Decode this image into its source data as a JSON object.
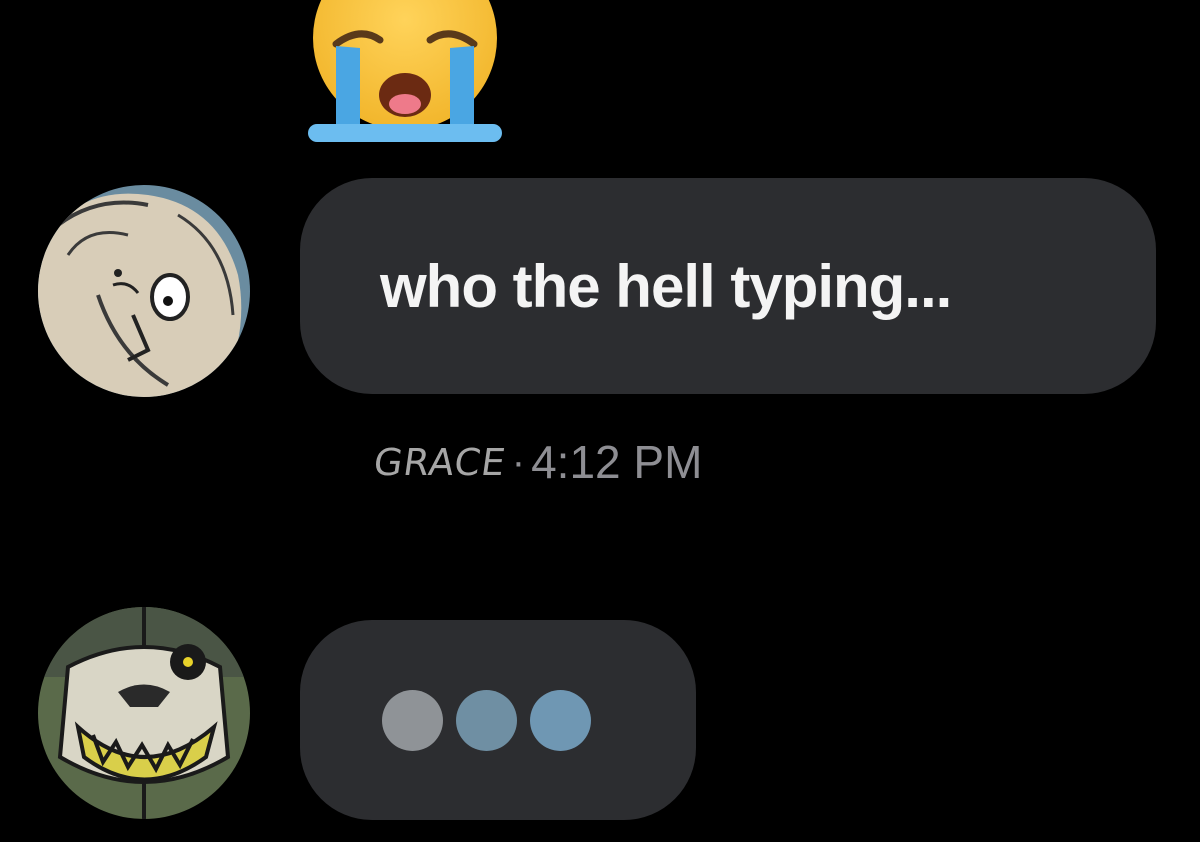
{
  "reaction": {
    "icon": "crying-face-icon"
  },
  "messages": [
    {
      "sender": "GRACE",
      "text": "who the hell typing...",
      "time": "4:12 PM",
      "separator": "·"
    }
  ],
  "typing_indicator": {
    "dot_colors": [
      "#8f9397",
      "#6f8fa3",
      "#6f97b3"
    ]
  },
  "colors": {
    "background": "#000000",
    "bubble": "#2c2d30",
    "message_text": "#f4f4f4",
    "meta_text": "#8e8e93",
    "reaction_face": "#f7c23a",
    "reaction_tears": "#4aa6e3"
  }
}
